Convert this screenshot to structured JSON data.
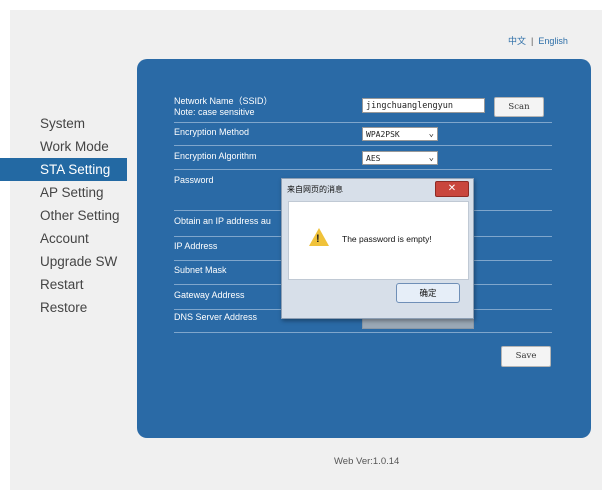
{
  "lang": {
    "zh": "中文",
    "sep": "|",
    "en": "English"
  },
  "nav": {
    "system": "System",
    "work_mode": "Work Mode",
    "sta_setting": "STA Setting",
    "ap_setting": "AP Setting",
    "other_setting": "Other Setting",
    "account": "Account",
    "upgrade": "Upgrade SW",
    "restart": "Restart",
    "restore": "Restore"
  },
  "form": {
    "ssid_label_1": "Network Name（SSID）",
    "ssid_label_2": "Note: case sensitive",
    "ssid_value": "jingchuanglengyun",
    "scan_label": "Scan",
    "enc_method_label": "Encryption Method",
    "enc_method_value": "WPA2PSK",
    "enc_algo_label": "Encryption Algorithm",
    "enc_algo_value": "AES",
    "password_label": "Password",
    "obtain_ip_label": "Obtain an IP address au",
    "ip_label": "IP Address",
    "subnet_label": "Subnet Mask",
    "gateway_label": "Gateway Address",
    "dns_label": "DNS Server Address",
    "save_label": "Save"
  },
  "dialog": {
    "title": "来自网页的消息",
    "close": "✕",
    "message": "The password is empty!",
    "ok": "确定"
  },
  "footer": {
    "version": "Web Ver:1.0.14"
  }
}
